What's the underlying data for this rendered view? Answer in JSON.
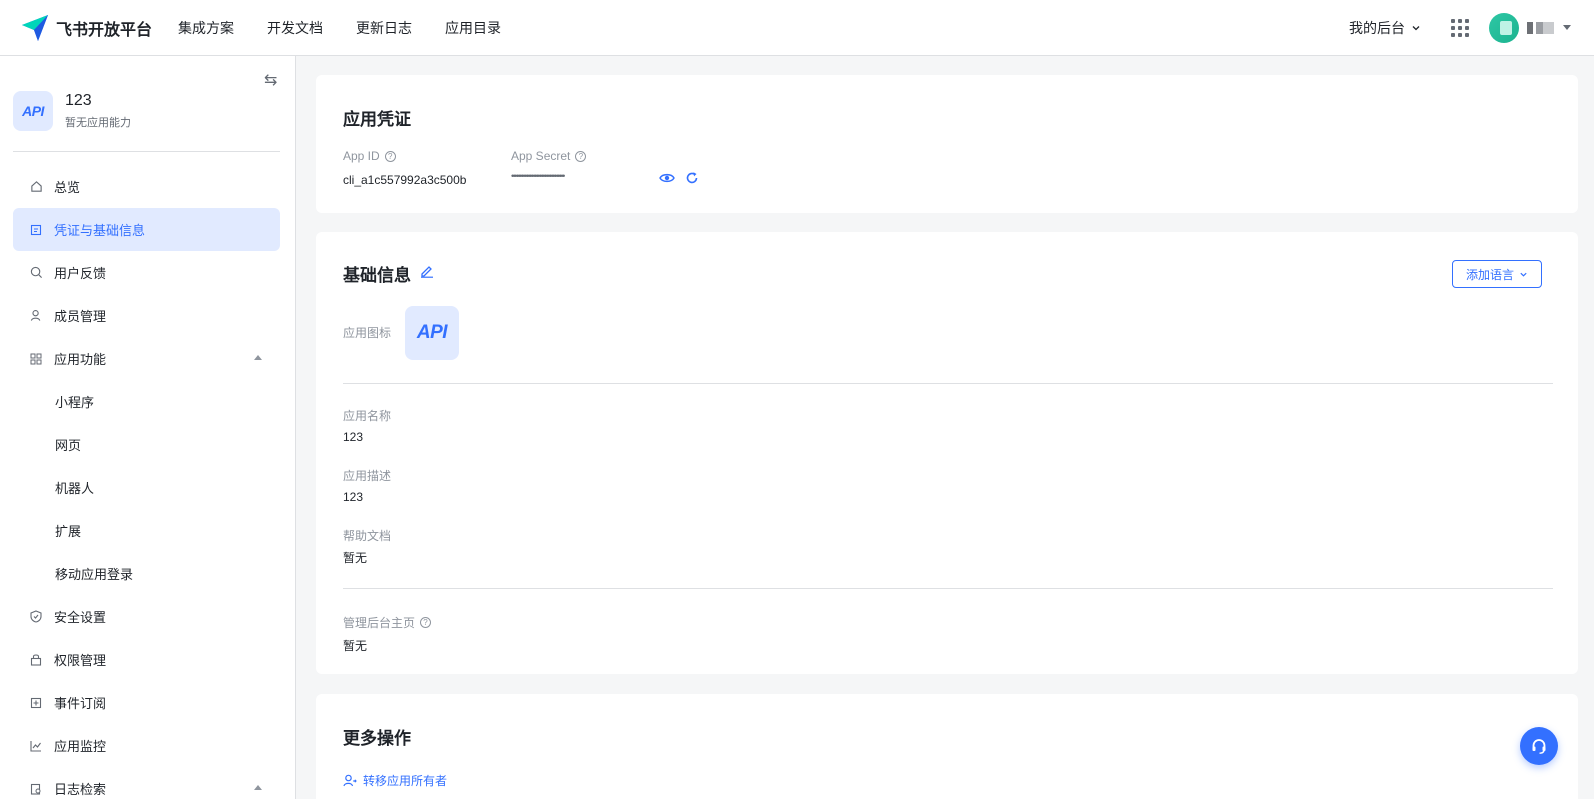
{
  "brand": {
    "name": "飞书开放平台",
    "accent": "#3370ff"
  },
  "topnav": {
    "items": [
      {
        "label": "集成方案"
      },
      {
        "label": "开发文档"
      },
      {
        "label": "更新日志"
      },
      {
        "label": "应用目录"
      }
    ],
    "console_label": "我的后台"
  },
  "sidebar": {
    "app_icon_text": "API",
    "app_name": "123",
    "app_sub": "暂无应用能力",
    "items": [
      {
        "label": "总览",
        "icon": "home-icon"
      },
      {
        "label": "凭证与基础信息",
        "icon": "credential-icon",
        "active": true
      },
      {
        "label": "用户反馈",
        "icon": "feedback-icon"
      },
      {
        "label": "成员管理",
        "icon": "member-icon"
      },
      {
        "label": "应用功能",
        "icon": "grid-icon",
        "expanded": true
      },
      {
        "label": "小程序",
        "sub": true
      },
      {
        "label": "网页",
        "sub": true
      },
      {
        "label": "机器人",
        "sub": true
      },
      {
        "label": "扩展",
        "sub": true
      },
      {
        "label": "移动应用登录",
        "sub": true
      },
      {
        "label": "安全设置",
        "icon": "shield-icon"
      },
      {
        "label": "权限管理",
        "icon": "lock-icon"
      },
      {
        "label": "事件订阅",
        "icon": "event-icon"
      },
      {
        "label": "应用监控",
        "icon": "chart-icon"
      },
      {
        "label": "日志检索",
        "icon": "log-icon",
        "expanded": true
      }
    ]
  },
  "credentials": {
    "title": "应用凭证",
    "app_id_label": "App ID",
    "app_id_value": "cli_a1c557992a3c500b",
    "secret_label": "App Secret",
    "secret_value": "••••••••••••••••••••••••••••••••"
  },
  "basic_info": {
    "title": "基础信息",
    "add_language_label": "添加语言",
    "icon_label": "应用图标",
    "icon_text": "API",
    "name_label": "应用名称",
    "name_value": "123",
    "desc_label": "应用描述",
    "desc_value": "123",
    "help_label": "帮助文档",
    "help_value": "暂无",
    "admin_label": "管理后台主页",
    "admin_value": "暂无"
  },
  "more_ops": {
    "title": "更多操作",
    "transfer_label": "转移应用所有者"
  }
}
